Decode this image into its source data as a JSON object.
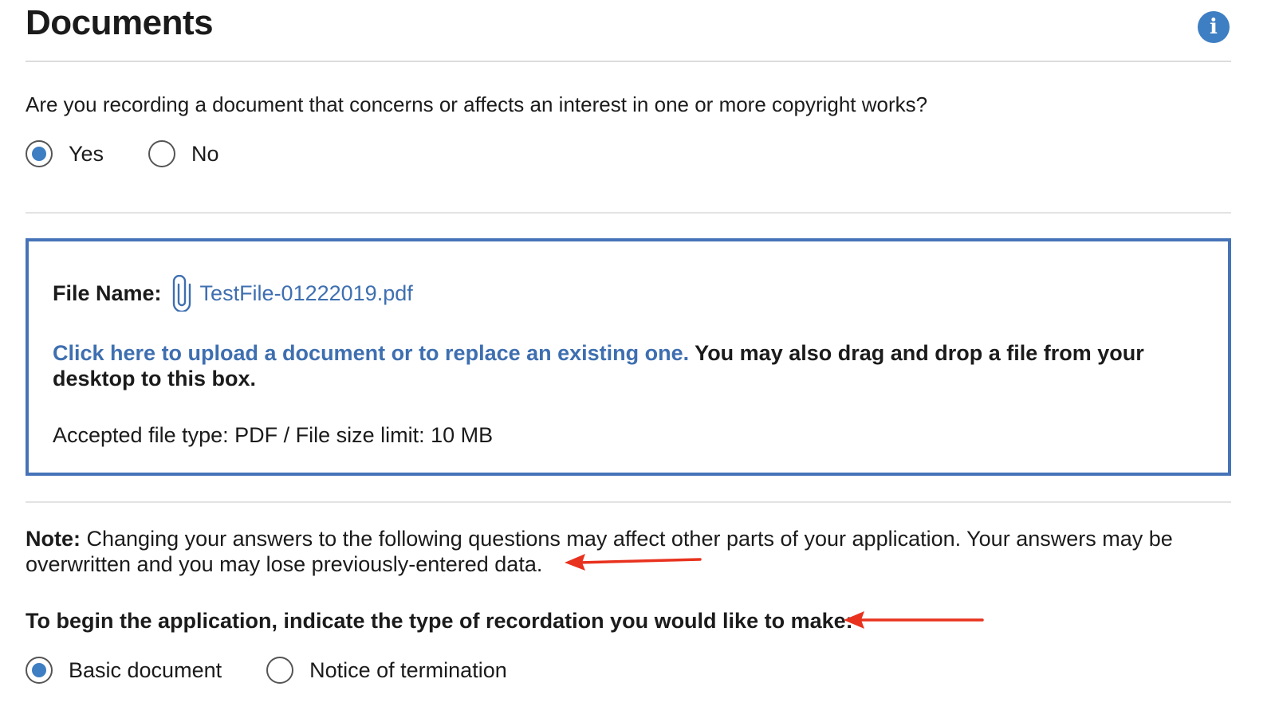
{
  "header": {
    "title": "Documents",
    "info_icon": "info-icon",
    "info_glyph": "i"
  },
  "question": {
    "text": "Are you recording a document that concerns or affects an interest in one or more copyright works?",
    "options": [
      {
        "label": "Yes",
        "selected": true
      },
      {
        "label": "No",
        "selected": false
      }
    ]
  },
  "upload": {
    "file_label": "File Name:",
    "file_icon": "paperclip-icon",
    "file_name": "TestFile-01222019.pdf",
    "upload_link": "Click here to upload a document or to replace an existing one.",
    "drag_text": " You may also drag and drop a file from your desktop to this box.",
    "accepted": "Accepted file type: PDF / File size limit: 10 MB"
  },
  "note": {
    "label": "Note:",
    "text": " Changing your answers to the following questions may affect other parts of your application. Your answers may be overwritten and you may lose previously-entered data."
  },
  "recordation": {
    "prompt": "To begin the application, indicate the type of recordation you would like to make:",
    "options": [
      {
        "label": "Basic document",
        "selected": true
      },
      {
        "label": "Notice of termination",
        "selected": false
      }
    ]
  },
  "colors": {
    "accent": "#3e7ec2",
    "link": "#3e6fb0",
    "box_border": "#4673b8",
    "annotation_arrow": "#e8321e"
  }
}
